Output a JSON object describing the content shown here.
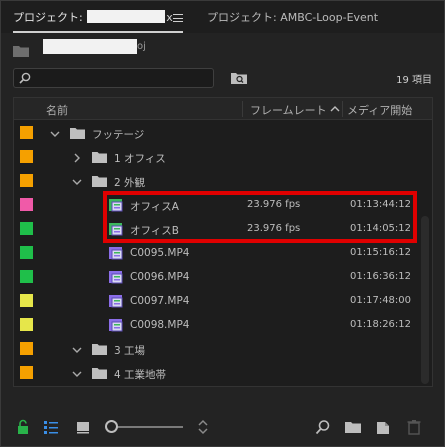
{
  "tabs": [
    {
      "label": "プロジェクト: ",
      "suffix": "x",
      "active": true
    },
    {
      "label": "プロジェクト: AMBC-Loop-Event",
      "active": false
    }
  ],
  "path": {
    "ext": "oj"
  },
  "search": {
    "value": "",
    "placeholder": ""
  },
  "item_count": "19 項目",
  "columns": {
    "name": "名前",
    "frame_rate": "フレームレート",
    "media_start": "メディア開始"
  },
  "colors": {
    "orange": "#f5a000",
    "pink": "#f05aa8",
    "green": "#1fbf4a",
    "yellow": "#e6e64a",
    "highlight": "#e00000",
    "accent_blue": "#3a8ee6",
    "lock_green": "#29b34a"
  },
  "rows": [
    {
      "type": "bin",
      "name": "フッテージ",
      "level": 0,
      "expanded": true,
      "label_color": "orange"
    },
    {
      "type": "bin",
      "name": "1 オフィス",
      "level": 1,
      "expanded": false,
      "label_color": "orange"
    },
    {
      "type": "bin",
      "name": "2 外観",
      "level": 1,
      "expanded": true,
      "label_color": "orange"
    },
    {
      "type": "sequence",
      "name": "オフィスA",
      "level": 2,
      "frame_rate": "23.976 fps",
      "media_start": "01:13:44:12",
      "label_color": "pink"
    },
    {
      "type": "sequence",
      "name": "オフィスB",
      "level": 2,
      "frame_rate": "23.976 fps",
      "media_start": "01:14:05:12",
      "label_color": "green"
    },
    {
      "type": "clip",
      "name": "C0095.MP4",
      "level": 2,
      "frame_rate": "",
      "media_start": "01:15:16:12",
      "label_color": "green"
    },
    {
      "type": "clip",
      "name": "C0096.MP4",
      "level": 2,
      "frame_rate": "",
      "media_start": "01:16:36:12",
      "label_color": "green"
    },
    {
      "type": "clip",
      "name": "C0097.MP4",
      "level": 2,
      "frame_rate": "",
      "media_start": "01:17:48:00",
      "label_color": "yellow"
    },
    {
      "type": "clip",
      "name": "C0098.MP4",
      "level": 2,
      "frame_rate": "",
      "media_start": "01:18:26:12",
      "label_color": "yellow"
    },
    {
      "type": "bin",
      "name": "3 工場",
      "level": 1,
      "expanded": true,
      "label_color": "orange"
    },
    {
      "type": "bin",
      "name": "4 工業地帯",
      "level": 1,
      "expanded": true,
      "label_color": "orange"
    }
  ],
  "toolbar_icons": [
    "lock-icon",
    "list-view-icon",
    "icon-view-icon",
    "zoom-slider",
    "sort-icon",
    "search-icon",
    "new-bin-icon",
    "new-item-icon",
    "trash-icon"
  ]
}
